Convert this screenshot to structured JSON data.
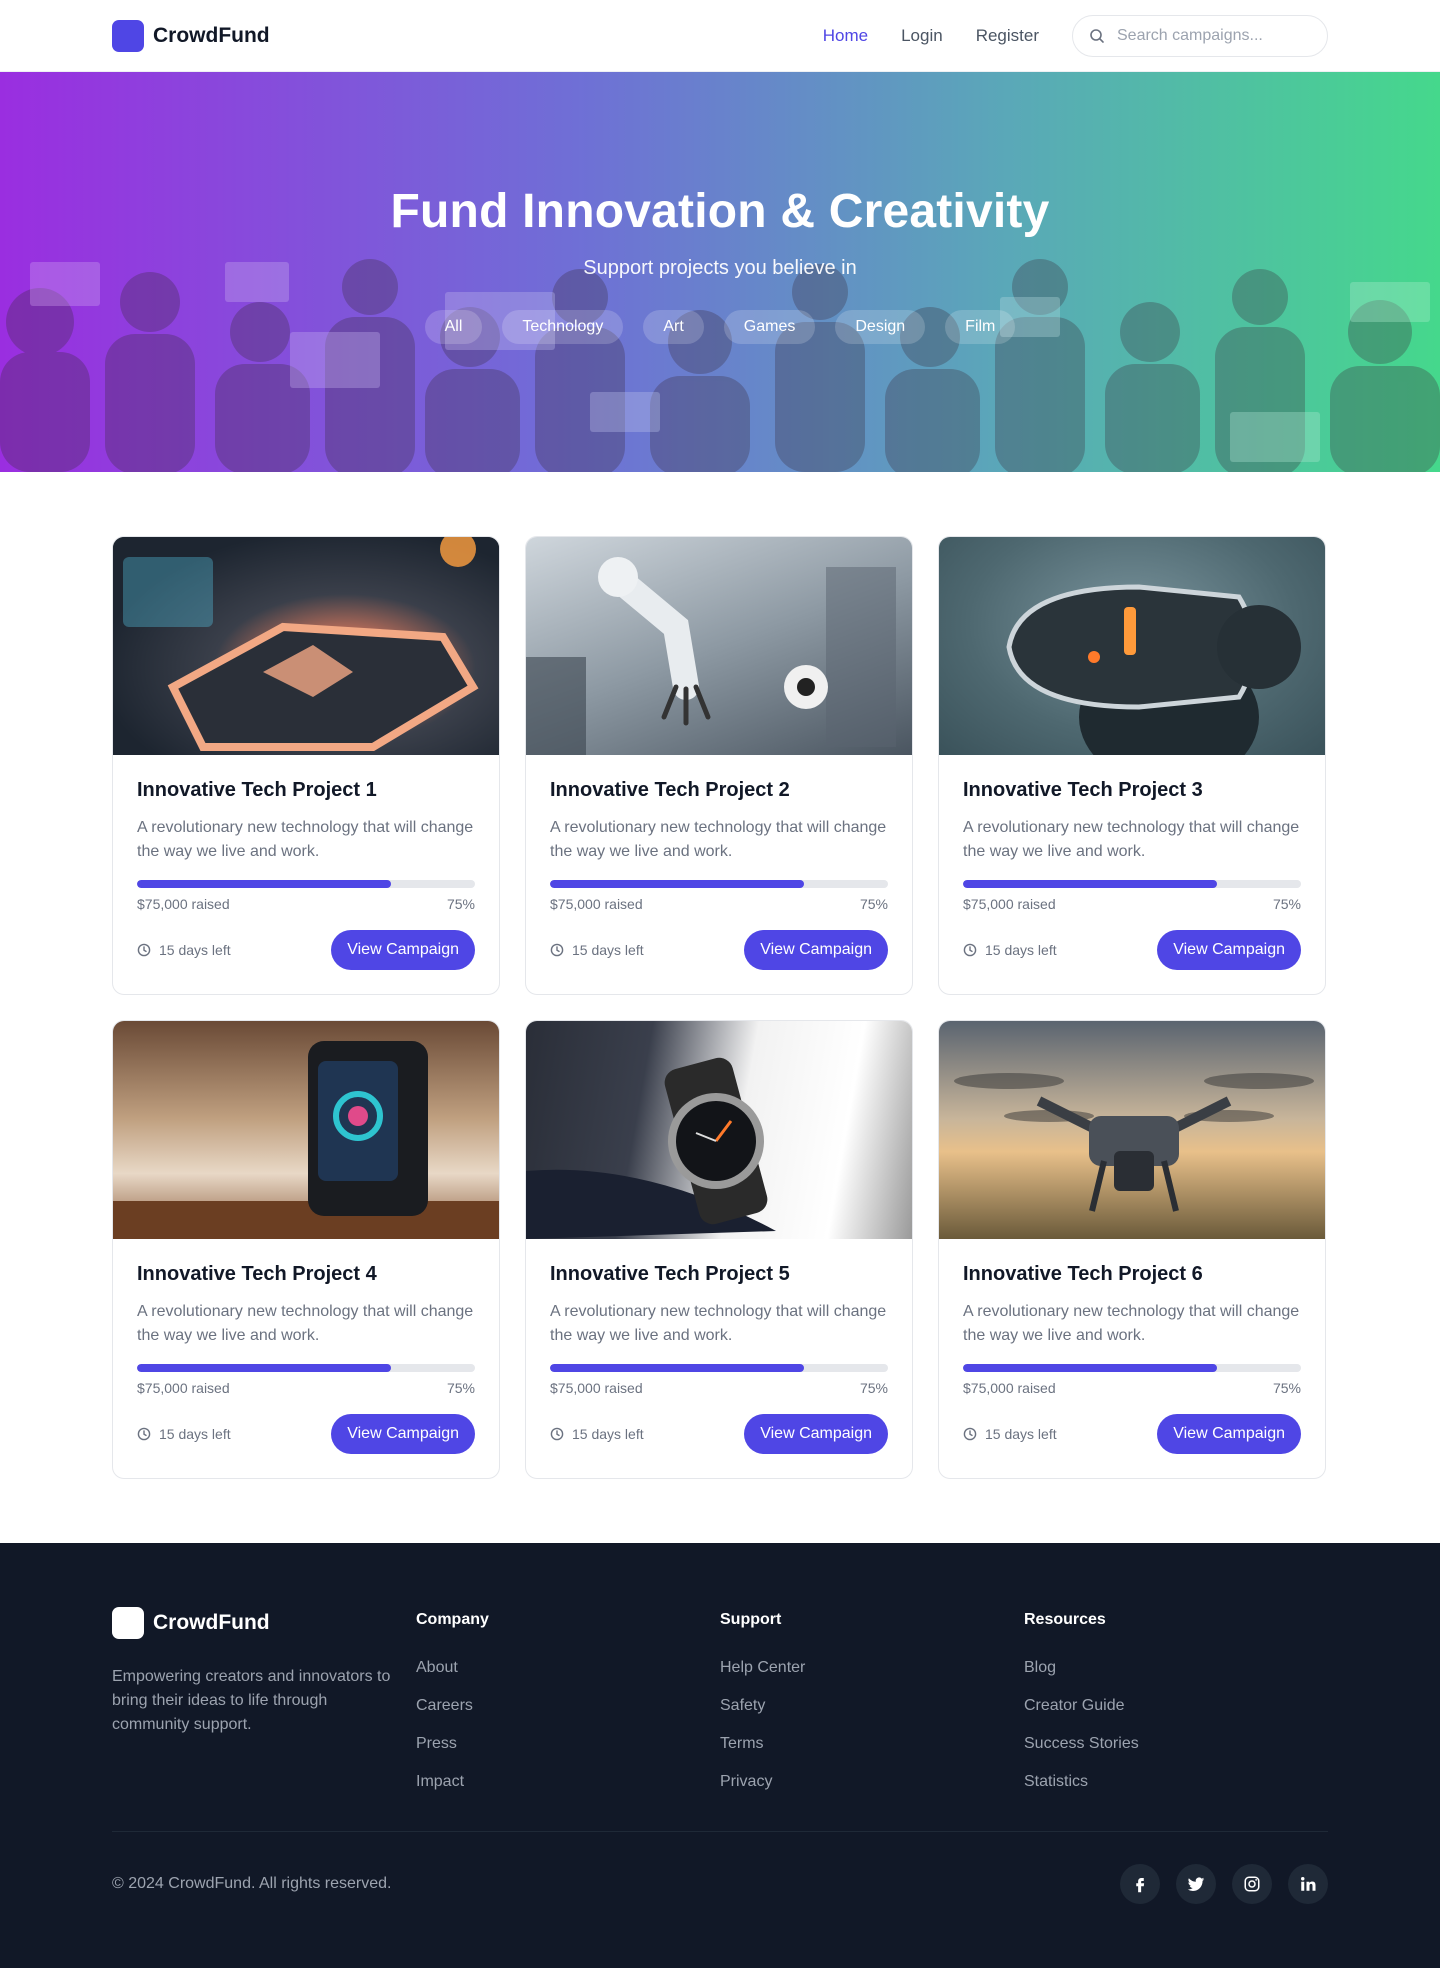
{
  "header": {
    "brand": "CrowdFund",
    "nav": [
      {
        "label": "Home",
        "active": true
      },
      {
        "label": "Login",
        "active": false
      },
      {
        "label": "Register",
        "active": false
      }
    ],
    "search_placeholder": "Search campaigns..."
  },
  "hero": {
    "title": "Fund Innovation & Creativity",
    "subtitle": "Support projects you believe in",
    "categories": [
      "All",
      "Technology",
      "Art",
      "Games",
      "Design",
      "Film"
    ]
  },
  "campaigns": [
    {
      "title": "Innovative Tech Project 1",
      "description": "A revolutionary new technology that will change the way we live and work.",
      "raised": "$75,000 raised",
      "percent_label": "75%",
      "progress": 0.75,
      "days_left": "15 days left",
      "button": "View Campaign",
      "image": "futuristic-device-image"
    },
    {
      "title": "Innovative Tech Project 2",
      "description": "A revolutionary new technology that will change the way we live and work.",
      "raised": "$75,000 raised",
      "percent_label": "75%",
      "progress": 0.75,
      "days_left": "15 days left",
      "button": "View Campaign",
      "image": "robotic-arm-lab-image"
    },
    {
      "title": "Innovative Tech Project 3",
      "description": "A revolutionary new technology that will change the way we live and work.",
      "raised": "$75,000 raised",
      "percent_label": "75%",
      "progress": 0.75,
      "days_left": "15 days left",
      "button": "View Campaign",
      "image": "vr-headset-image"
    },
    {
      "title": "Innovative Tech Project 4",
      "description": "A revolutionary new technology that will change the way we live and work.",
      "raised": "$75,000 raised",
      "percent_label": "75%",
      "progress": 0.75,
      "days_left": "15 days left",
      "button": "View Campaign",
      "image": "smart-home-device-image"
    },
    {
      "title": "Innovative Tech Project 5",
      "description": "A revolutionary new technology that will change the way we live and work.",
      "raised": "$75,000 raised",
      "percent_label": "75%",
      "progress": 0.75,
      "days_left": "15 days left",
      "button": "View Campaign",
      "image": "smartwatch-image"
    },
    {
      "title": "Innovative Tech Project 6",
      "description": "A revolutionary new technology that will change the way we live and work.",
      "raised": "$75,000 raised",
      "percent_label": "75%",
      "progress": 0.75,
      "days_left": "15 days left",
      "button": "View Campaign",
      "image": "drone-image"
    }
  ],
  "footer": {
    "brand": "CrowdFund",
    "tagline": "Empowering creators and innovators to bring their ideas to life through community support.",
    "columns": [
      {
        "heading": "Company",
        "links": [
          "About",
          "Careers",
          "Press",
          "Impact"
        ]
      },
      {
        "heading": "Support",
        "links": [
          "Help Center",
          "Safety",
          "Terms",
          "Privacy"
        ]
      },
      {
        "heading": "Resources",
        "links": [
          "Blog",
          "Creator Guide",
          "Success Stories",
          "Statistics"
        ]
      }
    ],
    "copyright": "© 2024 CrowdFund. All rights reserved.",
    "socials": [
      "facebook-icon",
      "twitter-icon",
      "instagram-icon",
      "linkedin-icon"
    ]
  },
  "colors": {
    "accent": "#4f46e5",
    "footer_bg": "#111827",
    "hero_gradient": [
      "#9a2ee0",
      "#45d88c"
    ]
  }
}
